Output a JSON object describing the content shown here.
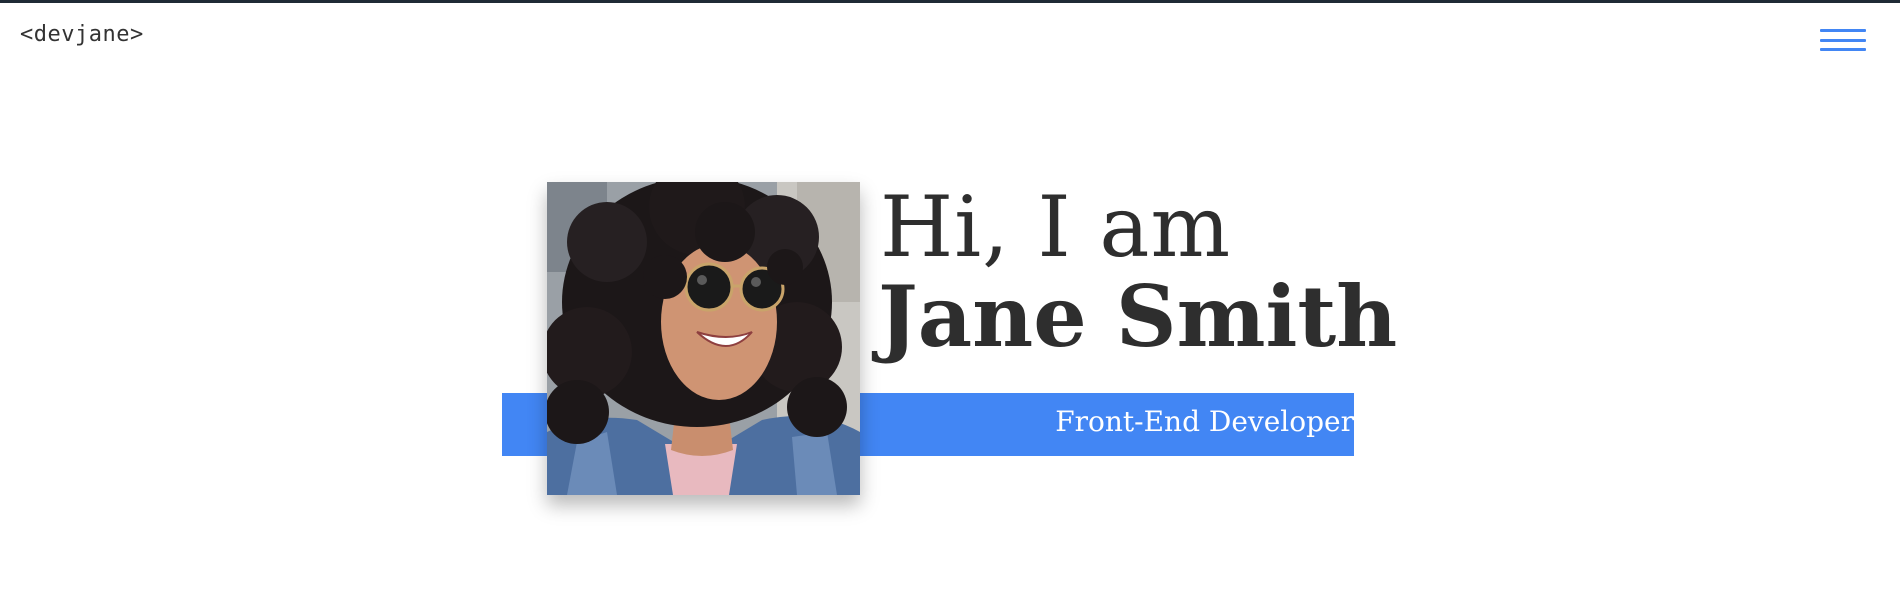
{
  "header": {
    "logo_text": "<devjane>",
    "menu_icon": "hamburger-menu-icon"
  },
  "hero": {
    "greeting": "Hi, I am",
    "name": "Jane Smith",
    "role": "Front-End Developer",
    "photo": "portrait of a smiling woman with curly hair and sunglasses"
  },
  "colors": {
    "accent": "#4286f4",
    "text": "#2e2e2e",
    "top_border": "#1f2a35",
    "background": "#ffffff"
  }
}
